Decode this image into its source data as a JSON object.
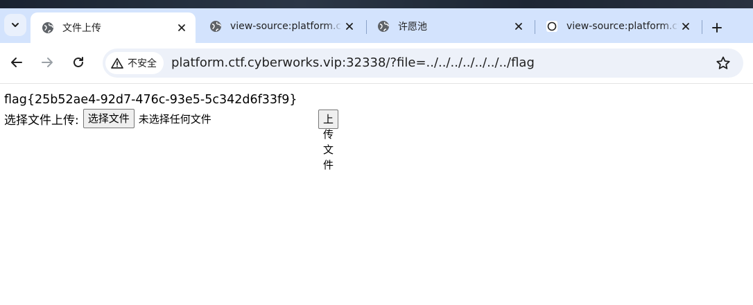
{
  "tabs": [
    {
      "title": "文件上传",
      "favicon": "globe-icon",
      "active": true
    },
    {
      "title": "view-source:platform.ctf.cyberworks.vip",
      "favicon": "globe-icon",
      "active": false
    },
    {
      "title": "许愿池",
      "favicon": "globe-icon",
      "active": false
    },
    {
      "title": "view-source:platform.ctf.cyberworks.vip",
      "favicon": "loading-icon",
      "active": false
    }
  ],
  "toolbar": {
    "security_label": "不安全",
    "url": "platform.ctf.cyberworks.vip:32338/?file=../../../../../../../flag"
  },
  "page": {
    "flag_text": "flag{25b52ae4-92d7-476c-93e5-5c342d6f33f9}",
    "upload_label": "选择文件上传:",
    "choose_button": "选择文件",
    "no_file_text": "未选择任何文件",
    "submit_button": "上传文件"
  },
  "colors": {
    "tabbar_bg": "#d3e3fd",
    "omnibox_bg": "#edf1f9",
    "page_bg": "#ffffff"
  }
}
